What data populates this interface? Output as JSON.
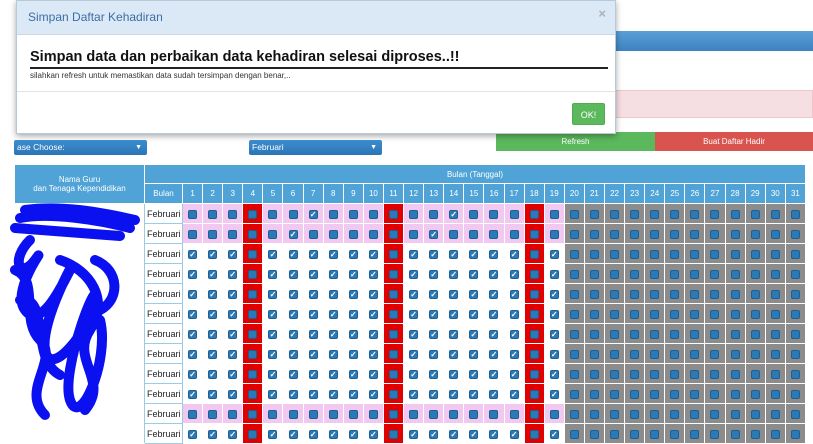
{
  "background": {
    "label_left": "",
    "label_mid": "",
    "select_left": "ase Choose:",
    "select_mid": "Februari",
    "refresh_button": "Refresh",
    "buat_button": "Buat Daftar Hadir"
  },
  "table": {
    "col_name_header_1": "Nama Guru",
    "col_name_header_2": "dan Tenaga Kependidikan",
    "month_group_header": "Bulan (Tanggal)",
    "bulan_header": "Bulan",
    "days": [
      1,
      2,
      3,
      4,
      5,
      6,
      7,
      8,
      9,
      10,
      11,
      12,
      13,
      14,
      15,
      16,
      17,
      18,
      19,
      20,
      21,
      22,
      23,
      24,
      25,
      26,
      27,
      28,
      29,
      30,
      31
    ],
    "rows": [
      {
        "month": "Februari",
        "pink": true,
        "checked_days": [
          7,
          14
        ]
      },
      {
        "month": "Februari",
        "pink": true,
        "checked_days": [
          6,
          13
        ]
      },
      {
        "month": "Februari",
        "pink": false,
        "checked_days": [
          1,
          2,
          3,
          5,
          6,
          7,
          8,
          9,
          10,
          12,
          13,
          14,
          15,
          16,
          17,
          19
        ]
      },
      {
        "month": "Februari",
        "pink": false,
        "checked_days": [
          1,
          2,
          3,
          5,
          6,
          7,
          8,
          9,
          10,
          12,
          13,
          14,
          15,
          16,
          17,
          19
        ]
      },
      {
        "month": "Februari",
        "pink": false,
        "checked_days": [
          1,
          2,
          3,
          5,
          6,
          7,
          8,
          9,
          10,
          12,
          13,
          14,
          15,
          16,
          17,
          19
        ]
      },
      {
        "month": "Februari",
        "pink": false,
        "checked_days": [
          1,
          2,
          3,
          5,
          6,
          7,
          8,
          9,
          10,
          12,
          13,
          14,
          15,
          16,
          17,
          19
        ]
      },
      {
        "month": "Februari",
        "pink": false,
        "checked_days": [
          1,
          2,
          3,
          5,
          6,
          7,
          8,
          9,
          10,
          12,
          13,
          14,
          15,
          16,
          17,
          19
        ]
      },
      {
        "month": "Februari",
        "pink": false,
        "checked_days": [
          1,
          2,
          3,
          5,
          6,
          7,
          8,
          9,
          10,
          12,
          13,
          14,
          15,
          16,
          17,
          19
        ]
      },
      {
        "month": "Februari",
        "pink": false,
        "checked_days": [
          1,
          2,
          3,
          5,
          6,
          7,
          8,
          9,
          10,
          12,
          13,
          14,
          15,
          16,
          17,
          19
        ]
      },
      {
        "month": "Februari",
        "pink": false,
        "checked_days": [
          1,
          2,
          3,
          5,
          6,
          7,
          8,
          9,
          10,
          12,
          13,
          14,
          15,
          16,
          17,
          19
        ]
      },
      {
        "month": "Februari",
        "pink": true,
        "checked_days": []
      },
      {
        "month": "Februari",
        "pink": false,
        "checked_days": [
          1,
          2,
          3,
          5,
          6,
          7,
          8,
          9,
          10,
          12,
          13,
          14,
          15,
          16,
          17,
          19
        ]
      }
    ],
    "weekend_days": [
      4,
      11,
      18
    ],
    "outside_days_from": 20
  },
  "modal": {
    "title": "Simpan Daftar Kehadiran",
    "close_symbol": "×",
    "message": "Simpan data dan perbaikan data kehadiran selesai diproses..!!",
    "sub_message": "silahkan refresh untuk memastikan data sudah tersimpan dengan benar,..",
    "ok_button": "OK!"
  },
  "colors": {
    "header_blue": "#4fa3d6",
    "weekend_red": "#e00000",
    "outside_gray": "#8c8c8c",
    "pink_row": "#f0c8f0",
    "ok_green": "#5cb85c",
    "buat_red": "#d9534f"
  }
}
